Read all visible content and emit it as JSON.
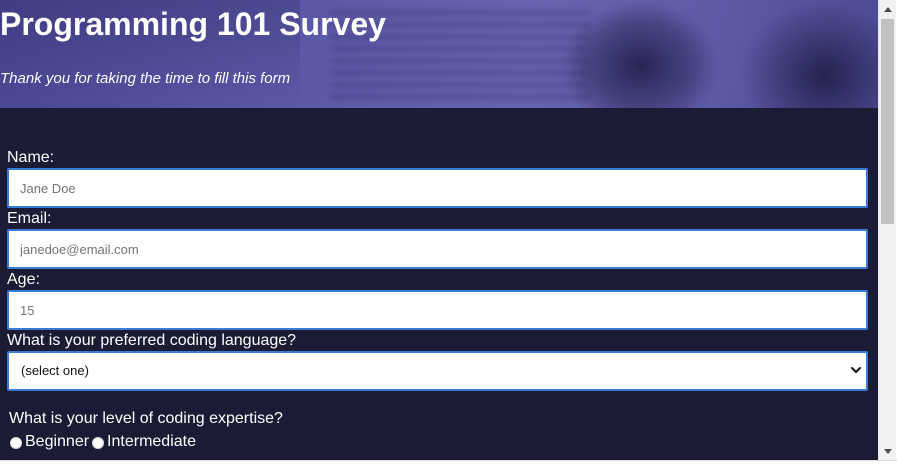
{
  "header": {
    "title": "Programming 101 Survey",
    "subtitle": "Thank you for taking the time to fill this form"
  },
  "form": {
    "name": {
      "label": "Name:",
      "placeholder": "Jane Doe"
    },
    "email": {
      "label": "Email:",
      "placeholder": "janedoe@email.com"
    },
    "age": {
      "label": "Age:",
      "placeholder": "15"
    },
    "language": {
      "label": "What is your preferred coding language?",
      "selected": "(select one)"
    },
    "expertise": {
      "question": "What is your level of coding expertise?",
      "options": [
        "Beginner",
        "Intermediate"
      ]
    }
  },
  "colors": {
    "background": "#1c1b36",
    "header": "#5b58a8",
    "input_border": "#3b7bd4"
  },
  "icons": {
    "select": "chevron-down-icon",
    "scroll_up": "arrow-up-icon",
    "scroll_down": "arrow-down-icon"
  }
}
